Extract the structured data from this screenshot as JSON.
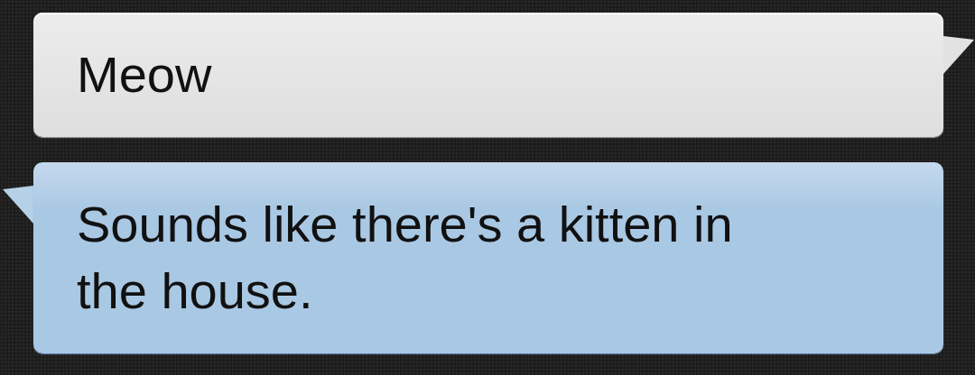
{
  "messages": [
    {
      "kind": "incoming",
      "text": "Meow"
    },
    {
      "kind": "outgoing",
      "text": "Sounds like there's a kitten in the house."
    }
  ]
}
